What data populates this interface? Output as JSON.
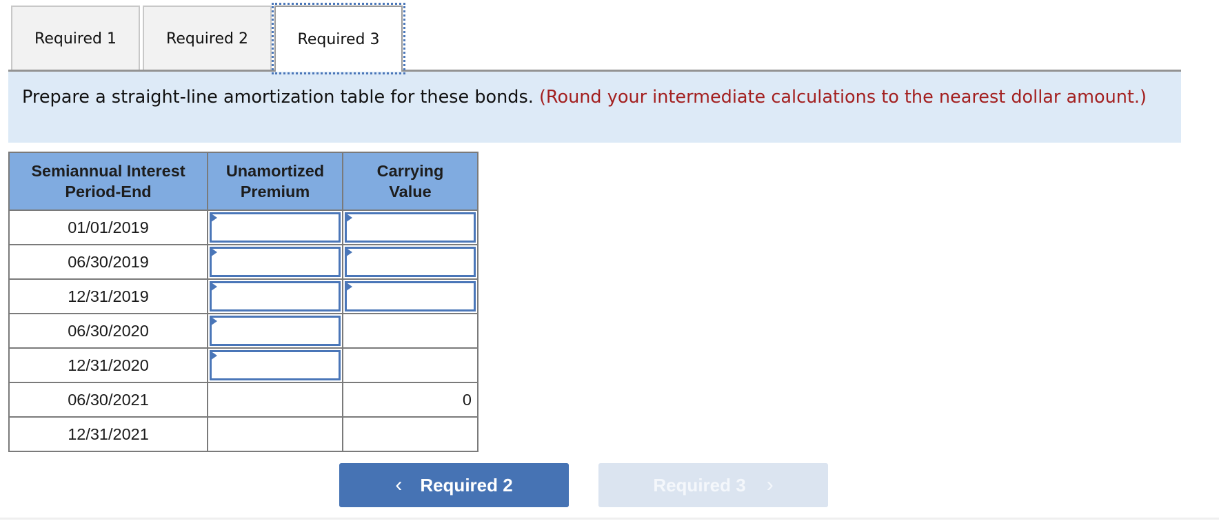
{
  "tabs": [
    {
      "label": "Required 1",
      "active": false
    },
    {
      "label": "Required 2",
      "active": false
    },
    {
      "label": "Required 3",
      "active": true
    }
  ],
  "instructions": {
    "text": "Prepare a straight-line amortization table for these bonds.",
    "note": "(Round your intermediate calculations to the nearest dollar amount.)"
  },
  "table": {
    "headers": [
      "Semiannual Interest Period-End",
      "Unamortized Premium",
      "Carrying Value"
    ],
    "header_lines": [
      [
        "Semiannual Interest",
        "Period-End"
      ],
      [
        "Unamortized",
        "Premium"
      ],
      [
        "Carrying",
        "Value"
      ]
    ],
    "rows": [
      {
        "period": "01/01/2019",
        "premium": "",
        "carrying": ""
      },
      {
        "period": "06/30/2019",
        "premium": "",
        "carrying": ""
      },
      {
        "period": "12/31/2019",
        "premium": "",
        "carrying": ""
      },
      {
        "period": "06/30/2020",
        "premium": "",
        "carrying": ""
      },
      {
        "period": "12/31/2020",
        "premium": "",
        "carrying": ""
      },
      {
        "period": "06/30/2021",
        "premium": "",
        "carrying": "0"
      },
      {
        "period": "12/31/2021",
        "premium": "",
        "carrying": ""
      }
    ]
  },
  "navigation": {
    "prev_label": "Required 2",
    "next_label": "Required 3",
    "prev_icon": "chevron-left-icon",
    "next_icon": "chevron-right-icon",
    "next_disabled": true
  },
  "colors": {
    "accent": "#4673b4",
    "header_bg": "#80abe0",
    "banner_bg": "#ddeaf7",
    "note_text": "#a32020"
  }
}
